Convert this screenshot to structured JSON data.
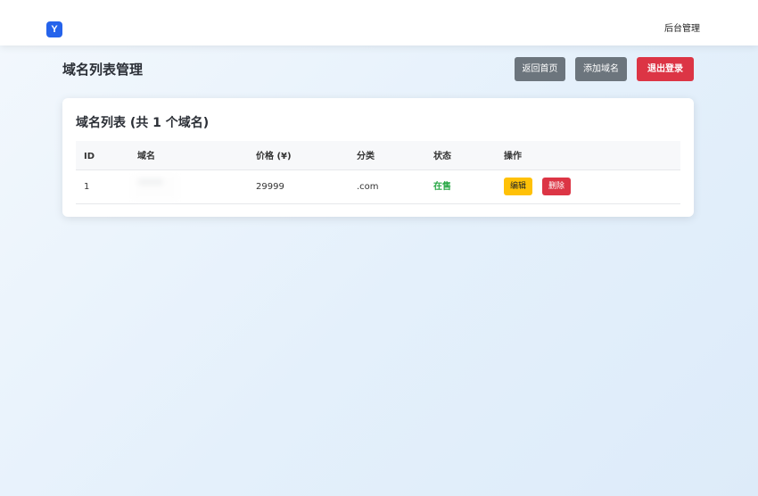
{
  "header": {
    "logo_text": "Y",
    "nav_admin": "后台管理"
  },
  "page": {
    "title": "域名列表管理",
    "buttons": {
      "home": "返回首页",
      "add_domain": "添加域名",
      "logout": "退出登录"
    }
  },
  "card": {
    "title": "域名列表 (共 1 个域名)",
    "columns": [
      "ID",
      "域名",
      "价格 (¥)",
      "分类",
      "状态",
      "操作"
    ],
    "rows": [
      {
        "id": "1",
        "price": "29999",
        "category": ".com",
        "status": "在售",
        "edit_label": "编辑",
        "delete_label": "删除"
      }
    ]
  },
  "colors": {
    "primary": "#2563eb",
    "gray_button": "#6c757d",
    "danger": "#dc3545",
    "warning": "#ffc107",
    "success": "#28a745"
  }
}
